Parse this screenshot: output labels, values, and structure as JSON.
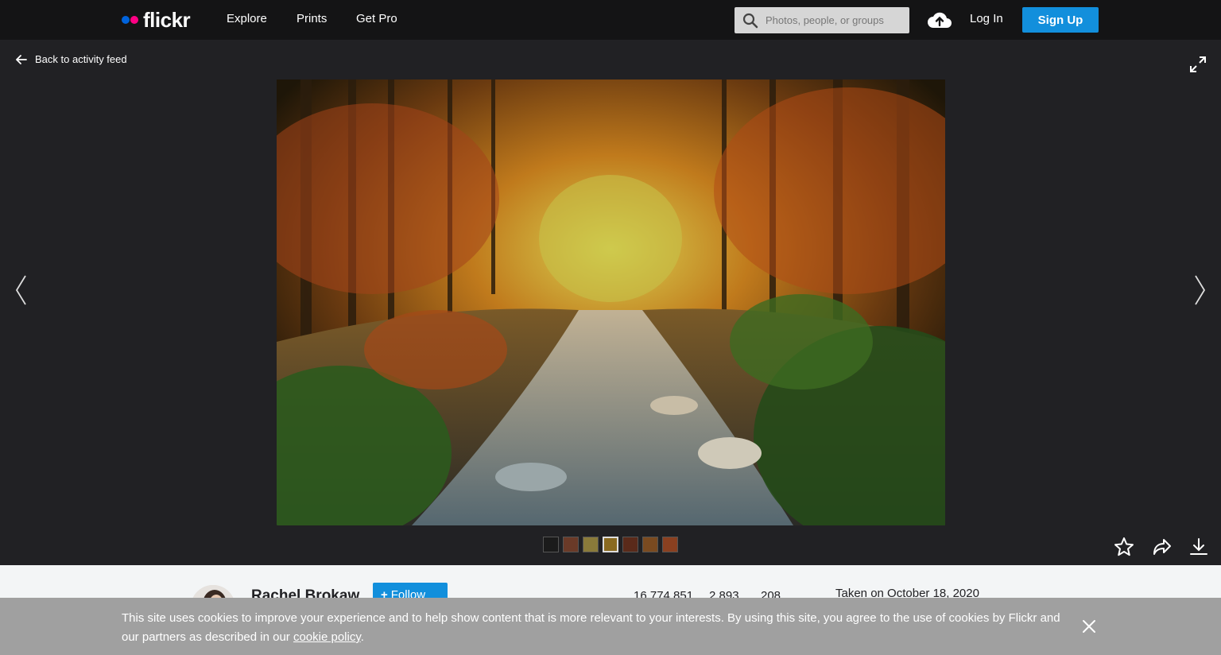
{
  "header": {
    "logo_text": "flickr",
    "nav": [
      "Explore",
      "Prints",
      "Get Pro"
    ],
    "search_placeholder": "Photos, people, or groups",
    "login_label": "Log In",
    "signup_label": "Sign Up"
  },
  "viewer": {
    "back_label": "Back to activity feed"
  },
  "owner": {
    "name": "Rachel Brokaw",
    "follow_label": "Follow",
    "stats": [
      "16,774,851",
      "2,893",
      "208"
    ],
    "taken": "Taken on October 18, 2020"
  },
  "cookie": {
    "text": "This site uses cookies to improve your experience and to help show content that is more relevant to your interests. By using this site, you agree to the use of cookies by Flickr and our partners as described in our ",
    "link": "cookie policy",
    "suffix": "."
  },
  "icons": [
    "search-icon",
    "upload-cloud-icon",
    "back-arrow-icon",
    "expand-icon",
    "chevron-left-icon",
    "chevron-right-icon",
    "star-icon",
    "share-icon",
    "download-icon",
    "close-icon"
  ],
  "colors": {
    "accent": "#128fdc",
    "logo_blue": "#0063dc",
    "logo_pink": "#ff0084"
  }
}
